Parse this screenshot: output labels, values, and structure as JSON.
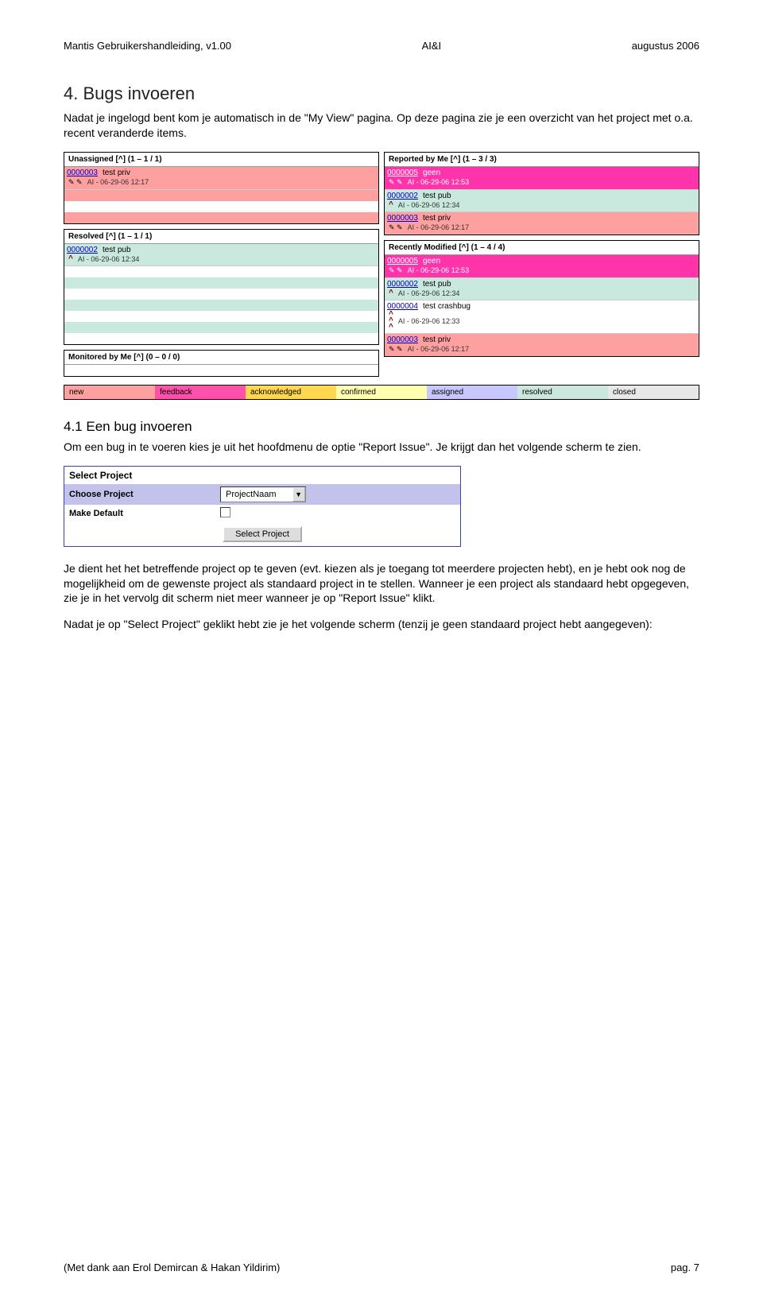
{
  "header": {
    "left": "Mantis Gebruikershandleiding, v1.00",
    "center": "AI&I",
    "right": "augustus 2006"
  },
  "section": {
    "title": "4. Bugs invoeren",
    "intro": "Nadat je ingelogd bent kom je automatisch in de \"My View\" pagina. Op deze pagina zie je een overzicht van het project met o.a. recent veranderde items."
  },
  "myview": {
    "left": {
      "unassigned": {
        "title": "Unassigned [^] (1 – 1 / 1)",
        "items": [
          {
            "id": "0000003",
            "text": "test priv",
            "meta": "AI - 06-29-06 12:17",
            "bg": "bg-pink",
            "icons": "pencils"
          }
        ]
      },
      "resolved": {
        "title": "Resolved [^] (1 – 1 / 1)",
        "items": [
          {
            "id": "0000002",
            "text": "test pub",
            "meta": "AI - 06-29-06 12:34",
            "bg": "bg-mint",
            "icons": "up1"
          }
        ]
      },
      "monitored": {
        "title": "Monitored by Me [^] (0 – 0 / 0)"
      }
    },
    "right": {
      "reported": {
        "title": "Reported by Me [^] (1 – 3 / 3)",
        "items": [
          {
            "id": "0000005",
            "text": "geen",
            "meta": "AI - 06-29-06 12:53",
            "bg": "bg-hotpink",
            "icons": "pencils"
          },
          {
            "id": "0000002",
            "text": "test pub",
            "meta": "AI - 06-29-06 12:34",
            "bg": "bg-mint",
            "icons": "up1"
          },
          {
            "id": "0000003",
            "text": "test priv",
            "meta": "AI - 06-29-06 12:17",
            "bg": "bg-pink",
            "icons": "pencils"
          }
        ]
      },
      "recent": {
        "title": "Recently Modified [^] (1 – 4 / 4)",
        "items": [
          {
            "id": "0000005",
            "text": "geen",
            "meta": "AI - 06-29-06 12:53",
            "bg": "bg-hotpink",
            "icons": "pencils"
          },
          {
            "id": "0000002",
            "text": "test pub",
            "meta": "AI - 06-29-06 12:34",
            "bg": "bg-mint",
            "icons": "up1"
          },
          {
            "id": "0000004",
            "text": "test crashbug",
            "meta": "AI - 06-29-06 12:33",
            "bg": "bg-white",
            "icons": "up3"
          },
          {
            "id": "0000003",
            "text": "test priv",
            "meta": "AI - 06-29-06 12:17",
            "bg": "bg-pink",
            "icons": "pencils"
          }
        ]
      }
    }
  },
  "legend": {
    "new": "new",
    "feedback": "feedback",
    "ack": "acknowledged",
    "conf": "confirmed",
    "asg": "assigned",
    "res": "resolved",
    "cls": "closed"
  },
  "sub": {
    "title": "4.1 Een bug invoeren",
    "p1": "Om een bug in te voeren kies je uit het hoofdmenu de optie \"Report Issue\". Je krijgt dan het volgende scherm te zien."
  },
  "selproj": {
    "title": "Select Project",
    "choose_label": "Choose Project",
    "choose_value": "ProjectNaam",
    "default_label": "Make Default",
    "button": "Select Project"
  },
  "after": {
    "p1": "Je dient het het betreffende project op te geven (evt. kiezen als je toegang tot meerdere projecten hebt), en je hebt ook nog de mogelijkheid om de gewenste project als standaard project in te stellen. Wanneer je een project als standaard hebt opgegeven, zie je in het vervolg dit scherm niet meer wanneer je op \"Report Issue\" klikt.",
    "p2": "Nadat je op \"Select Project\" geklikt hebt zie je het volgende scherm (tenzij je geen standaard project hebt aangegeven):"
  },
  "footer": {
    "left": "(Met dank aan Erol Demircan & Hakan Yildirim)",
    "right": "pag. 7"
  }
}
